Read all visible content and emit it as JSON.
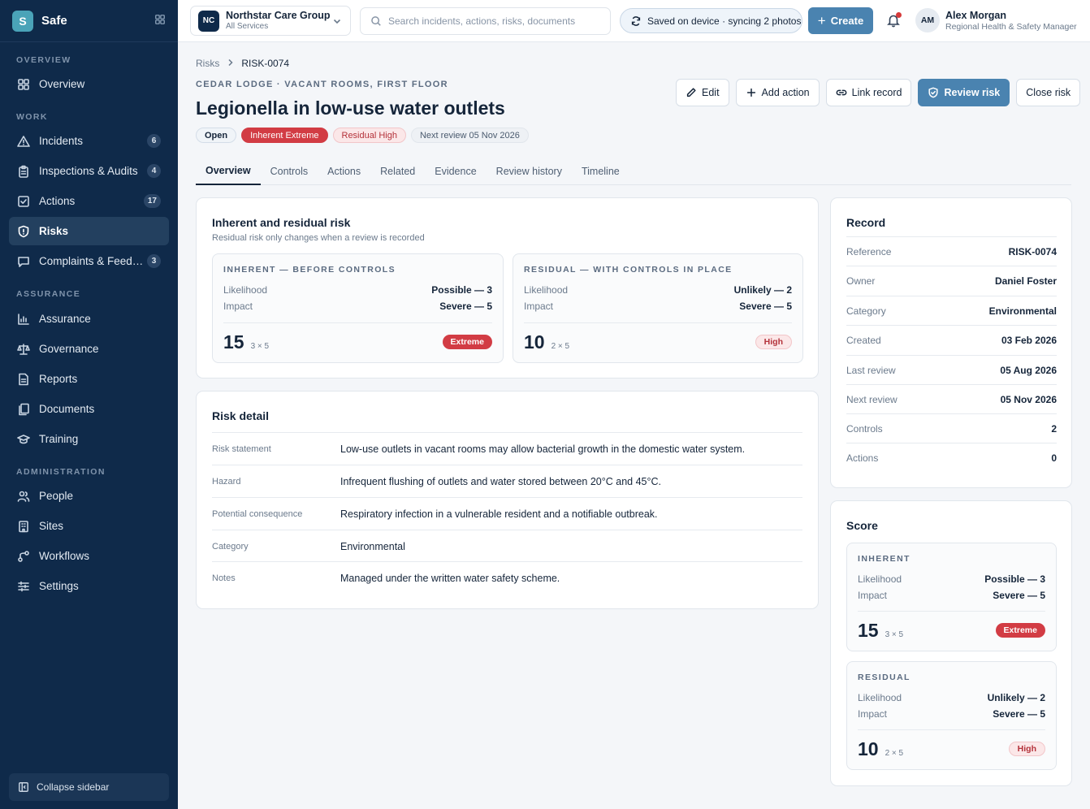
{
  "brand": {
    "logo_letter": "S",
    "name": "Safe"
  },
  "sidebar": {
    "sections": [
      "OVERVIEW",
      "WORK",
      "ASSURANCE",
      "ADMINISTRATION"
    ],
    "items": [
      {
        "label": "Overview",
        "icon": "grid-icon"
      },
      {
        "label": "Incidents",
        "icon": "warning-icon",
        "badge": "6"
      },
      {
        "label": "Inspections & Audits",
        "icon": "clipboard-icon",
        "badge": "4"
      },
      {
        "label": "Actions",
        "icon": "checkbox-icon",
        "badge": "17"
      },
      {
        "label": "Risks",
        "icon": "shield-icon",
        "active": true
      },
      {
        "label": "Complaints & Feed…",
        "icon": "chat-icon",
        "badge": "3"
      },
      {
        "label": "Assurance",
        "icon": "bar-chart-icon"
      },
      {
        "label": "Governance",
        "icon": "scales-icon"
      },
      {
        "label": "Reports",
        "icon": "report-icon"
      },
      {
        "label": "Documents",
        "icon": "documents-icon"
      },
      {
        "label": "Training",
        "icon": "graduation-icon"
      },
      {
        "label": "People",
        "icon": "people-icon"
      },
      {
        "label": "Sites",
        "icon": "building-icon"
      },
      {
        "label": "Workflows",
        "icon": "workflow-icon"
      },
      {
        "label": "Settings",
        "icon": "sliders-icon"
      }
    ],
    "collapse_label": "Collapse sidebar"
  },
  "topbar": {
    "org_badge": "NC",
    "org_name": "Northstar Care Group",
    "org_sub": "All Services",
    "search_placeholder": "Search incidents, actions, risks, documents",
    "sync_status": "Saved on device · syncing 2 photos",
    "create_label": "Create",
    "user_initials": "AM",
    "user_name": "Alex Morgan",
    "user_role": "Regional Health & Safety Manager"
  },
  "breadcrumb": {
    "parent": "Risks",
    "current": "RISK-0074"
  },
  "header": {
    "eyebrow": "CEDAR LODGE · VACANT ROOMS, FIRST FLOOR",
    "title": "Legionella in low-use water outlets",
    "chips": [
      "Open",
      "Inherent Extreme",
      "Residual High",
      "Next review 05 Nov 2026"
    ],
    "buttons": {
      "edit": "Edit",
      "add_action": "Add action",
      "link_record": "Link record",
      "review_risk": "Review risk",
      "close_risk": "Close risk"
    }
  },
  "tabs": [
    "Overview",
    "Controls",
    "Actions",
    "Related",
    "Evidence",
    "Review history",
    "Timeline"
  ],
  "risk_card": {
    "title": "Inherent and residual risk",
    "subtitle": "Residual risk only changes when a review is recorded",
    "inherent": {
      "heading": "INHERENT — BEFORE CONTROLS",
      "likelihood_label": "Likelihood",
      "likelihood": "Possible — 3",
      "impact_label": "Impact",
      "impact": "Severe — 5",
      "score": "15",
      "formula": "3 × 5",
      "rating": "Extreme"
    },
    "residual": {
      "heading": "RESIDUAL — WITH CONTROLS IN PLACE",
      "likelihood_label": "Likelihood",
      "likelihood": "Unlikely — 2",
      "impact_label": "Impact",
      "impact": "Severe — 5",
      "score": "10",
      "formula": "2 × 5",
      "rating": "High"
    }
  },
  "detail": {
    "title": "Risk detail",
    "rows": [
      {
        "label": "Risk statement",
        "value": "Low-use outlets in vacant rooms may allow bacterial growth in the domestic water system."
      },
      {
        "label": "Hazard",
        "value": "Infrequent flushing of outlets and water stored between 20°C and 45°C."
      },
      {
        "label": "Potential consequence",
        "value": "Respiratory infection in a vulnerable resident and a notifiable outbreak."
      },
      {
        "label": "Category",
        "value": "Environmental"
      },
      {
        "label": "Notes",
        "value": "Managed under the written water safety scheme."
      }
    ]
  },
  "record": {
    "title": "Record",
    "rows": [
      {
        "label": "Reference",
        "value": "RISK-0074"
      },
      {
        "label": "Owner",
        "value": "Daniel Foster"
      },
      {
        "label": "Category",
        "value": "Environmental"
      },
      {
        "label": "Created",
        "value": "03 Feb 2026"
      },
      {
        "label": "Last review",
        "value": "05 Aug 2026"
      },
      {
        "label": "Next review",
        "value": "05 Nov 2026"
      },
      {
        "label": "Controls",
        "value": "2"
      },
      {
        "label": "Actions",
        "value": "0"
      }
    ]
  },
  "score": {
    "title": "Score",
    "inherent": {
      "heading": "INHERENT",
      "likelihood_label": "Likelihood",
      "likelihood": "Possible — 3",
      "impact_label": "Impact",
      "impact": "Severe — 5",
      "score": "15",
      "formula": "3 × 5",
      "rating": "Extreme"
    },
    "residual": {
      "heading": "RESIDUAL",
      "likelihood_label": "Likelihood",
      "likelihood": "Unlikely — 2",
      "impact_label": "Impact",
      "impact": "Severe — 5",
      "score": "10",
      "formula": "2 × 5",
      "rating": "High"
    }
  },
  "colors": {
    "sidebar_bg": "#0f2a4a",
    "primary": "#4a83b0",
    "extreme": "#d23c44",
    "high_bg": "#fbe7e8"
  }
}
